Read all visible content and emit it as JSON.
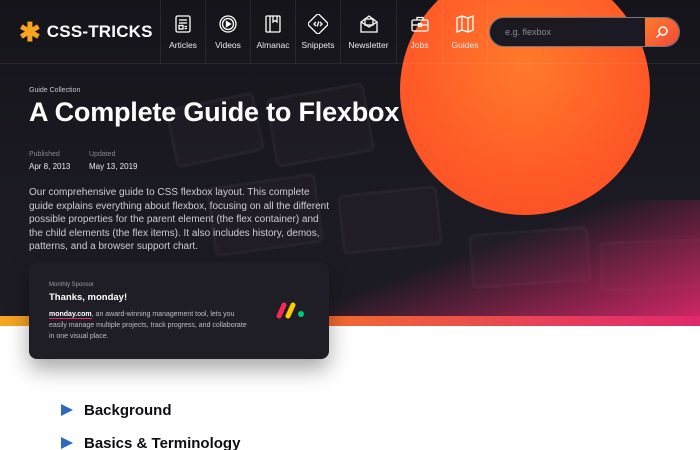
{
  "brand": {
    "name": "CSS-TRICKS",
    "accent": "#f7a520"
  },
  "nav": {
    "items": [
      {
        "label": "Articles",
        "icon": "articles-icon"
      },
      {
        "label": "Videos",
        "icon": "videos-icon"
      },
      {
        "label": "Almanac",
        "icon": "almanac-icon"
      },
      {
        "label": "Snippets",
        "icon": "snippets-icon"
      },
      {
        "label": "Newsletter",
        "icon": "newsletter-icon"
      },
      {
        "label": "Jobs",
        "icon": "jobs-icon"
      },
      {
        "label": "Guides",
        "icon": "guides-icon"
      }
    ]
  },
  "search": {
    "placeholder": "e.g. flexbox",
    "button_icon": "search-icon"
  },
  "article": {
    "collection": "Guide Collection",
    "title": "A Complete Guide to Flexbox",
    "published_label": "Published",
    "published_date": "Apr 8, 2013",
    "updated_label": "Updated",
    "updated_date": "May 13, 2019",
    "description": "Our comprehensive guide to CSS flexbox layout. This complete guide explains everything about flexbox, focusing on all the different possible properties for the parent element (the flex container) and the child elements (the flex items). It also includes history, demos, patterns, and a browser support chart."
  },
  "sponsor": {
    "label": "Monthly Sponsor",
    "title": "Thanks, monday!",
    "link": "monday.com",
    "body": ", an award-winning management tool, lets you easily manage multiple projects, track progress, and collaborate in one visual place.",
    "logo_icon": "monday-logo-icon"
  },
  "toc": {
    "items": [
      {
        "label": "Background"
      },
      {
        "label": "Basics & Terminology"
      }
    ],
    "arrow_color": "#2f69bd"
  },
  "colors": {
    "hero_bg": "#1b1a22",
    "sun": "#ff5c27",
    "gradient_end": "#e0286c"
  }
}
